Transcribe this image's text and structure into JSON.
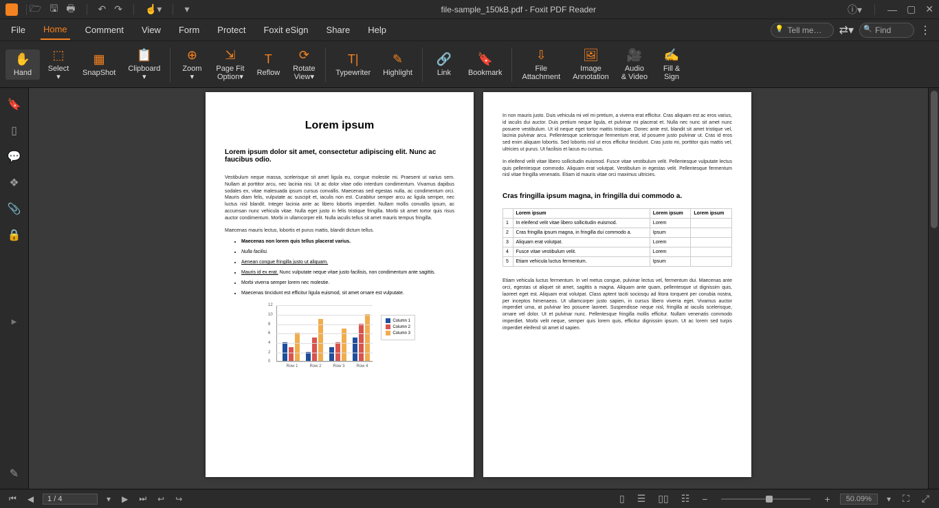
{
  "title": "file-sample_150kB.pdf - Foxit PDF Reader",
  "tabs": [
    "File",
    "Home",
    "Comment",
    "View",
    "Form",
    "Protect",
    "Foxit eSign",
    "Share",
    "Help"
  ],
  "activeTab": 1,
  "tellme": "Tell me…",
  "find": "Find",
  "ribbon": [
    {
      "lbl": "Hand",
      "ico": "✋",
      "active": true
    },
    {
      "lbl": "Select\n▾",
      "ico": "⬚"
    },
    {
      "lbl": "SnapShot",
      "ico": "▦"
    },
    {
      "lbl": "Clipboard\n▾",
      "ico": "📋"
    },
    {
      "sep": true
    },
    {
      "lbl": "Zoom\n▾",
      "ico": "⊕"
    },
    {
      "lbl": "Page Fit\nOption▾",
      "ico": "⇲"
    },
    {
      "lbl": "Reflow",
      "ico": "T"
    },
    {
      "lbl": "Rotate\nView▾",
      "ico": "⟳"
    },
    {
      "sep": true
    },
    {
      "lbl": "Typewriter",
      "ico": "T|"
    },
    {
      "lbl": "Highlight",
      "ico": "✎"
    },
    {
      "sep": true
    },
    {
      "lbl": "Link",
      "ico": "🔗"
    },
    {
      "lbl": "Bookmark",
      "ico": "🔖"
    },
    {
      "sep": true
    },
    {
      "lbl": "File\nAttachment",
      "ico": "⇩"
    },
    {
      "lbl": "Image\nAnnotation",
      "ico": "🖼"
    },
    {
      "lbl": "Audio\n& Video",
      "ico": "🎥"
    },
    {
      "lbl": "Fill &\nSign",
      "ico": "✍"
    }
  ],
  "page1": {
    "h1": "Lorem ipsum",
    "h2": "Lorem ipsum dolor sit amet, consectetur adipiscing elit. Nunc ac faucibus odio.",
    "p1": "Vestibulum neque massa, scelerisque sit amet ligula eu, congue molestie mi. Praesent ut varius sem. Nullam at porttitor arcu, nec lacinia nisi. Ut ac dolor vitae odio interdum condimentum. Vivamus dapibus sodales ex, vitae malesuada ipsum cursus convallis. Maecenas sed egestas nulla, ac condimentum orci. Mauris diam felis, vulputate ac suscipit et, iaculis non est. Curabitur semper arcu ac ligula semper, nec luctus nisl blandit. Integer lacinia ante ac libero lobortis imperdiet. Nullam mollis convallis ipsum, ac accumsan nunc vehicula vitae. Nulla eget justo in felis tristique fringilla. Morbi sit amet tortor quis risus auctor condimentum. Morbi in ullamcorper elit. Nulla iaculis tellus sit amet mauris tempus fringilla.",
    "p2": "Maecenas mauris lectus, lobortis et purus mattis, blandit dictum tellus.",
    "list": [
      {
        "t": "Maecenas non lorem quis tellus placerat varius.",
        "b": true
      },
      {
        "t": "Nulla facilisi.",
        "i": true
      },
      {
        "t": "Aenean congue fringilla justo ut aliquam. ",
        "u": true
      },
      {
        "t": "Mauris id ex erat. Nunc vulputate neque vitae justo facilisis, non condimentum ante sagittis.",
        "mu": true
      },
      {
        "t": "Morbi viverra semper lorem nec molestie."
      },
      {
        "t": "Maecenas tincidunt est efficitur ligula euismod, sit amet ornare est vulputate."
      }
    ]
  },
  "chart_data": {
    "type": "bar",
    "categories": [
      "Row 1",
      "Row 2",
      "Row 3",
      "Row 4"
    ],
    "series": [
      {
        "name": "Column 1",
        "color": "#1f4e9c",
        "values": [
          4,
          2,
          3,
          5
        ]
      },
      {
        "name": "Column 2",
        "color": "#d9534f",
        "values": [
          3,
          5,
          4,
          8
        ]
      },
      {
        "name": "Column 3",
        "color": "#f0ad4e",
        "values": [
          6,
          9,
          7,
          10
        ]
      }
    ],
    "ylim": [
      0,
      12
    ],
    "yticks": [
      0,
      2,
      4,
      6,
      8,
      10,
      12
    ]
  },
  "page2": {
    "p1": "In non mauris justo. Duis vehicula mi vel mi pretium, a viverra erat efficitur. Cras aliquam est ac eros varius, id iaculis dui auctor. Duis pretium neque ligula, et pulvinar mi placerat et. Nulla nec nunc sit amet nunc posuere vestibulum. Ut id neque eget tortor mattis tristique. Donec ante est, blandit sit amet tristique vel, lacinia pulvinar arcu. Pellentesque scelerisque fermentum erat, id posuere justo pulvinar ut. Cras id eros sed enim aliquam lobortis. Sed lobortis nisl ut eros efficitur tincidunt. Cras justo mi, porttitor quis mattis vel, ultricies ut purus. Ut facilisis et lacus eu cursus.",
    "p2": "In eleifend velit vitae libero sollicitudin euismod. Fusce vitae vestibulum velit. Pellentesque vulputate lectus quis pellentesque commodo. Aliquam erat volutpat. Vestibulum in egestas velit. Pellentesque fermentum nisl vitae fringilla venenatis. Etiam id mauris vitae orci maximus ultricies.",
    "h3": "Cras fringilla ipsum magna, in fringilla dui commodo a.",
    "table": {
      "head": [
        "",
        "Lorem ipsum",
        "Lorem ipsum",
        "Lorem ipsum"
      ],
      "rows": [
        [
          "1",
          "In eleifend velit vitae libero sollicitudin euismod.",
          "Lorem",
          ""
        ],
        [
          "2",
          "Cras fringilla ipsum magna, in fringilla dui commodo a.",
          "Ipsum",
          ""
        ],
        [
          "3",
          "Aliquam erat volutpat.",
          "Lorem",
          ""
        ],
        [
          "4",
          "Fusce vitae vestibulum velit.",
          "Lorem",
          ""
        ],
        [
          "5",
          "Etiam vehicula luctus fermentum.",
          "Ipsum",
          ""
        ]
      ]
    },
    "p3": "Etiam vehicula luctus fermentum. In vel metus congue, pulvinar lectus vel, fermentum dui. Maecenas ante orci, egestas ut aliquet sit amet, sagittis a magna. Aliquam ante quam, pellentesque ut dignissim quis, laoreet eget est. Aliquam erat volutpat. Class aptent taciti sociosqu ad litora torquent per conubia nostra, per inceptos himenaeos. Ut ullamcorper justo sapien, in cursus libero viverra eget. Vivamus auctor imperdiet urna, at pulvinar leo posuere laoreet. Suspendisse neque nisl, fringilla at iaculis scelerisque, ornare vel dolor. Ut et pulvinar nunc. Pellentesque fringilla mollis efficitur. Nullam venenatis commodo imperdiet. Morbi velit neque, semper quis lorem quis, efficitur dignissim ipsum. Ut ac lorem sed turpis imperdiet eleifend sit amet id sapien."
  },
  "status": {
    "page": "1 / 4",
    "zoom": "50.09%"
  }
}
